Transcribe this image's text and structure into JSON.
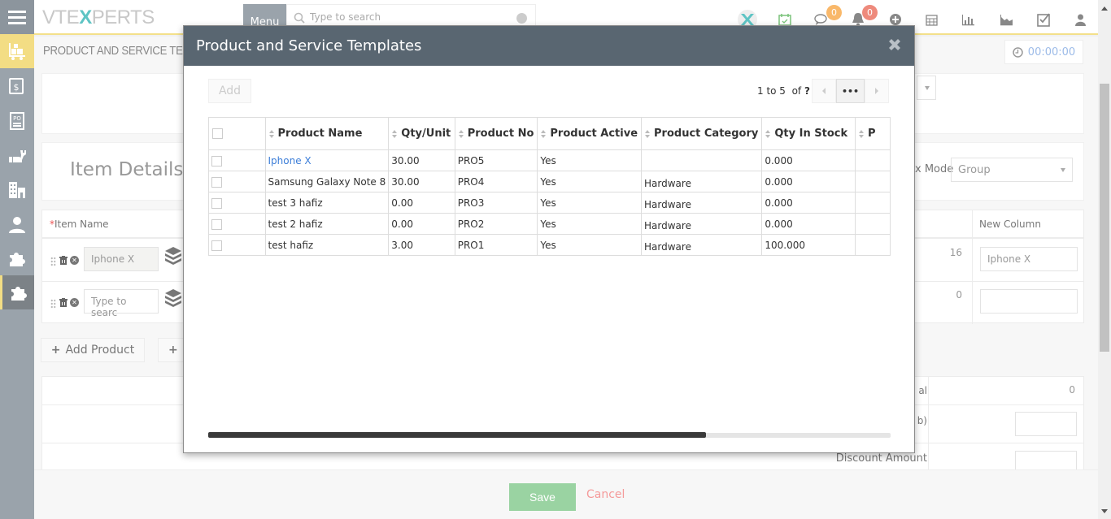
{
  "app": {
    "logo_text_pre": "VTE",
    "logo_text_x": "X",
    "logo_text_post": "PERTS",
    "menu_label": "Menu",
    "search_placeholder": "Type to search"
  },
  "topbar": {
    "icons": [
      {
        "name": "vtexperts-x-icon"
      },
      {
        "name": "calendar-check-icon"
      },
      {
        "name": "chat-icon",
        "badge": "0",
        "badge_color": "#f9b86a"
      },
      {
        "name": "bell-icon",
        "badge": "0",
        "badge_color": "#ee8a7c"
      },
      {
        "name": "plus-circle-icon"
      },
      {
        "name": "calendar-icon"
      },
      {
        "name": "bar-chart-icon"
      },
      {
        "name": "area-chart-icon"
      },
      {
        "name": "checkbox-icon"
      },
      {
        "name": "user-icon"
      }
    ]
  },
  "sidebar": {
    "items": [
      {
        "name": "menu-hamburger-icon"
      },
      {
        "name": "cart-boxes-icon",
        "active": "yellow"
      },
      {
        "name": "invoice-dollar-icon"
      },
      {
        "name": "purchase-order-icon"
      },
      {
        "name": "hand-wrench-icon"
      },
      {
        "name": "building-icon"
      },
      {
        "name": "contact-person-icon"
      },
      {
        "name": "puzzle-icon"
      },
      {
        "name": "puzzle-active-icon",
        "active": "dark"
      }
    ]
  },
  "page": {
    "breadcrumb": "PRODUCT AND SERVICE TE...",
    "breadcrumb_sep": ">",
    "timer": "00:00:00",
    "item_details_title": "Item Details",
    "tax_mode_label": "x Mode",
    "tax_mode_value": "Group",
    "item_name_label": "Item Name",
    "required_mark": "*",
    "new_column_label": "New Column",
    "rows": [
      {
        "item_value": "Iphone X",
        "number": "16",
        "new_column_value": "Iphone X"
      },
      {
        "item_placeholder": "Type to searc",
        "number": "0",
        "new_column_value": ""
      }
    ],
    "add_product_label": "Add Product",
    "add_other_label": "",
    "totals": {
      "items_total_label": "al",
      "items_total_value": "0",
      "discount_pct_label": "b)",
      "discount_amount_label": "Discount Amount"
    },
    "save_label": "Save",
    "cancel_label": "Cancel"
  },
  "modal": {
    "title": "Product and Service Templates",
    "add_label": "Add",
    "pager": {
      "range": "1 to 5",
      "of_label": "of",
      "total": "?",
      "more_label": "•••"
    },
    "columns": [
      "Product Name",
      "Qty/Unit",
      "Product No",
      "Product Active",
      "Product Category",
      "Qty In Stock",
      "P"
    ],
    "rows": [
      {
        "name": "Iphone X",
        "link": true,
        "qty_unit": "30.00",
        "product_no": "PRO5",
        "active": "Yes",
        "category": "",
        "qty_in_stock": "0.000"
      },
      {
        "name": "Samsung Galaxy Note 8",
        "link": false,
        "qty_unit": "30.00",
        "product_no": "PRO4",
        "active": "Yes",
        "category": "Hardware",
        "qty_in_stock": "0.000"
      },
      {
        "name": "test 3 hafiz",
        "link": false,
        "qty_unit": "0.00",
        "product_no": "PRO3",
        "active": "Yes",
        "category": "Hardware",
        "qty_in_stock": "0.000"
      },
      {
        "name": "test 2 hafiz",
        "link": false,
        "qty_unit": "0.00",
        "product_no": "PRO2",
        "active": "Yes",
        "category": "Hardware",
        "qty_in_stock": "0.000"
      },
      {
        "name": "test hafiz",
        "link": false,
        "qty_unit": "3.00",
        "product_no": "PRO1",
        "active": "Yes",
        "category": "Hardware",
        "qty_in_stock": "100.000"
      }
    ],
    "horizontal_scroll_fraction": 0.73
  },
  "colors": {
    "modal_header": "#596671",
    "accent_yellow": "#f3dd84",
    "link_blue": "#3b7dd8",
    "save_green": "#9ad3a2",
    "cancel_red": "#f59a9a",
    "timer_blue": "#9cbbe8"
  }
}
